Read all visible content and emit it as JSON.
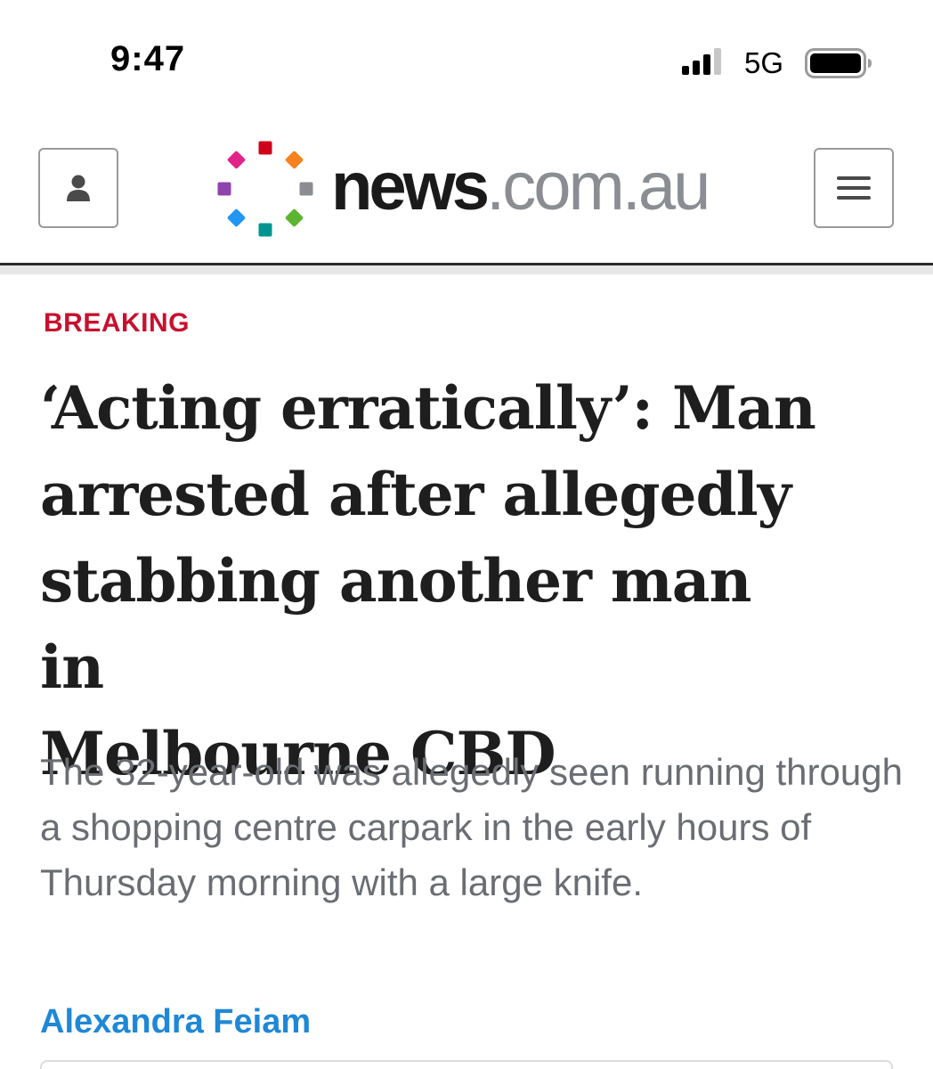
{
  "status_bar": {
    "time": "9:47",
    "network": "5G",
    "signal_icon": "cellular-signal-icon",
    "battery_icon": "battery-icon"
  },
  "header": {
    "logo": {
      "wordmark_primary": "news",
      "wordmark_secondary": ".com.au",
      "mark_colors": [
        "#d0021b",
        "#f5821f",
        "#8a8e92",
        "#5cb531",
        "#00968f",
        "#2196f3",
        "#8e44ad",
        "#e0248a"
      ]
    },
    "account_icon": "person-icon",
    "menu_icon": "hamburger-menu-icon"
  },
  "article": {
    "category": "BREAKING",
    "headline_lines": [
      "‘Acting erratically’: Man",
      "arrested after allegedly",
      "stabbing another man in",
      "Melbourne CBD"
    ],
    "standfirst": "The 32-year-old was allegedly seen running through a shopping centre carpark in the early hours of Thursday morning with a large knife.",
    "author": "Alexandra Feiam"
  },
  "colors": {
    "breaking": "#c8102e",
    "author_link": "#1e88d6",
    "standfirst": "#6a6e73"
  }
}
